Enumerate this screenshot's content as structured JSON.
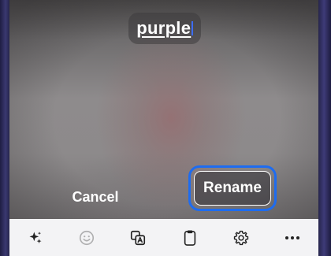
{
  "filename_field": {
    "value": "purple"
  },
  "actions": {
    "cancel_label": "Cancel",
    "rename_label": "Rename"
  },
  "toolbar": {
    "items": [
      {
        "icon": "sparkle-ai-icon",
        "enabled": true
      },
      {
        "icon": "emoji-icon",
        "enabled": false
      },
      {
        "icon": "image-text-icon",
        "enabled": true
      },
      {
        "icon": "clipboard-icon",
        "enabled": true
      },
      {
        "icon": "gear-icon",
        "enabled": true
      },
      {
        "icon": "more-options-icon",
        "enabled": true
      }
    ]
  },
  "colors": {
    "focus_ring": "#1e6cf0",
    "caret": "#3d6cff",
    "toolbar_bg": "#f3f3f5",
    "device_frame": "#2b2a52"
  }
}
